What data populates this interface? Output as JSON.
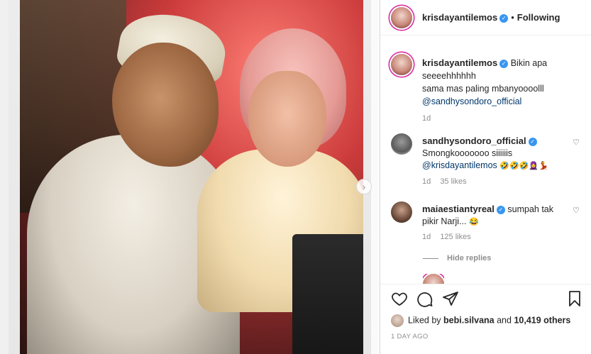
{
  "post": {
    "author": "krisdayantilemos",
    "follow_status": "Following",
    "separator": "•"
  },
  "caption": {
    "author": "krisdayantilemos",
    "line1": "Bikin apa",
    "line2": "seeeehhhhhh",
    "line3": "sama mas paling mbanyoooolll",
    "mention": "@sandhysondoro_official",
    "age": "1d"
  },
  "comments": [
    {
      "author": "sandhysondoro_official",
      "text": "Smongkooooooo siiiiiis",
      "mention": "@krisdayantilemos",
      "emojis": "🤣🤣🤣🧕💃",
      "age": "1d",
      "likes": "35 likes"
    },
    {
      "author": "maiaestiantyreal",
      "text": "sumpah tak pikir Narji...",
      "emojis": "😂",
      "age": "1d",
      "likes": "125 likes"
    }
  ],
  "hide_replies": "Hide replies",
  "likes": {
    "prefix": "Liked by",
    "user": "bebi.silvana",
    "connector": "and",
    "count": "10,419 others"
  },
  "posted_time": "1 DAY AGO",
  "icons": {
    "verified": "verified-badge-icon",
    "heart": "heart-icon",
    "comment": "comment-icon",
    "share": "share-icon",
    "save": "bookmark-icon",
    "next": "chevron-right-icon"
  },
  "colors": {
    "verified": "#3897f0",
    "mention": "#00376b",
    "muted": "#8e8e8e",
    "story_ring": "#d6249f"
  }
}
